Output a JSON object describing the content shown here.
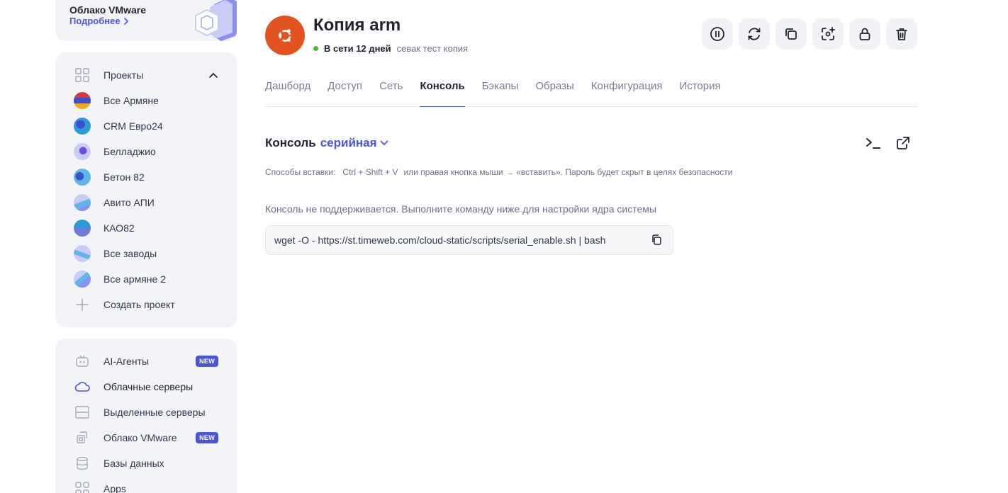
{
  "promo": {
    "title": "Облако VMware",
    "link": "Подробнее"
  },
  "projects": {
    "header": "Проекты",
    "items": [
      {
        "label": "Все Армяне"
      },
      {
        "label": "CRM Евро24"
      },
      {
        "label": "Белладжио"
      },
      {
        "label": "Бетон 82"
      },
      {
        "label": "Авито АПИ"
      },
      {
        "label": "КАО82"
      },
      {
        "label": "Все заводы"
      },
      {
        "label": "Все армяне 2"
      }
    ],
    "create": "Создать проект"
  },
  "services": {
    "items": [
      {
        "label": "AI-Агенты",
        "badge": "NEW",
        "icon": "robot-icon"
      },
      {
        "label": "Облачные серверы",
        "icon": "cloud-icon"
      },
      {
        "label": "Выделенные серверы",
        "icon": "server-icon"
      },
      {
        "label": "Облако VMware",
        "badge": "NEW",
        "icon": "vmware-icon"
      },
      {
        "label": "Базы данных",
        "icon": "database-icon"
      },
      {
        "label": "Apps",
        "icon": "apps-icon"
      }
    ]
  },
  "server": {
    "title": "Копия arm",
    "status": "В сети 12 дней",
    "description": "севак тест копия"
  },
  "tabs": [
    "Дашборд",
    "Доступ",
    "Сеть",
    "Консоль",
    "Бэкапы",
    "Образы",
    "Конфигурация",
    "История"
  ],
  "console": {
    "title": "Консоль",
    "mode": "серийная",
    "paste_prefix": "Способы вставки:",
    "paste_keys": "Ctrl + Shift + V",
    "paste_rest": "или правая кнопка мыши → «вставить». Пароль будет скрыт в целях безопасности",
    "note": "Консоль не поддерживается. Выполните команду ниже для настройки ядра системы",
    "command": "wget -O - https://st.timeweb.com/cloud-static/scripts/serial_enable.sh | bash"
  },
  "colors": {
    "accent": "#4a55d8",
    "ubuntu": "#e3531f",
    "online": "#4cb82b"
  }
}
